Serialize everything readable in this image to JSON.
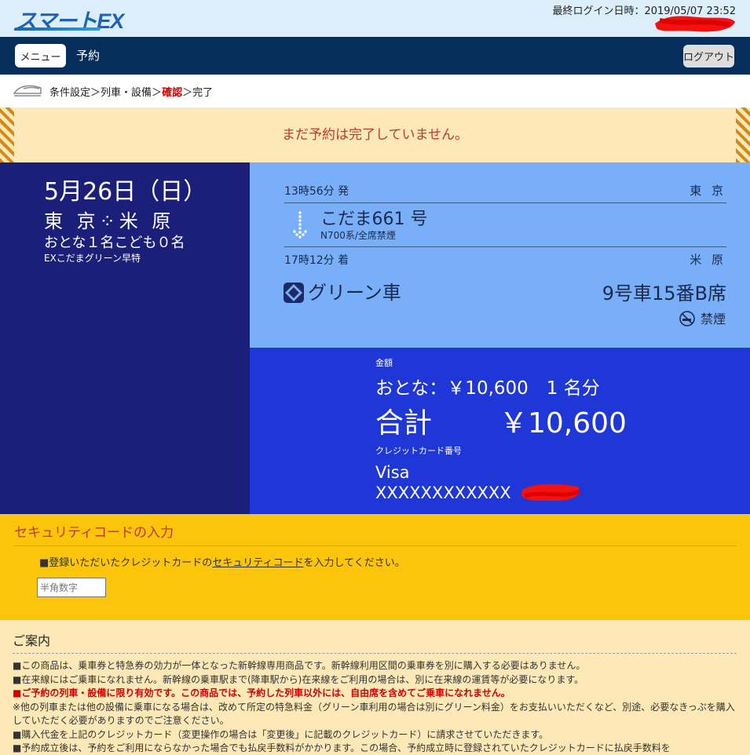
{
  "header": {
    "logo": "スマートEX",
    "last_login": "最終ログイン日時：2019/05/07 23:52"
  },
  "nav": {
    "menu_label": "メニュー",
    "title": "予約",
    "logout_label": "ログアウト"
  },
  "breadcrumb": {
    "step1": "条件設定",
    "sep1": "＞",
    "step2": "列車・設備",
    "sep2": "＞",
    "step3": "確認",
    "sep3": "＞",
    "step4": "完了"
  },
  "warning": "まだ予約は完了していません。",
  "summary": {
    "date": "5月26日（日）",
    "route": "東 京⁘米 原",
    "passengers": "おとな１名こども０名",
    "fare_type": "EXこだまグリーン早特"
  },
  "train": {
    "dep_time": "13時56分 発",
    "dep_station": "東 京",
    "name": "こだま661 号",
    "type": "N700系/全席禁煙",
    "arr_time": "17時12分 着",
    "arr_station": "米 原",
    "car_class": "グリーン車",
    "seat": "9号車15番B席",
    "smoking": "禁煙"
  },
  "fare": {
    "label": "金額",
    "line": "おとな：￥10,600　1 名分",
    "total_label": "合計",
    "total_value": "￥10,600",
    "card_label": "クレジットカード番号",
    "card_brand": "Visa",
    "card_number": "XXXXXXXXXXXX"
  },
  "security": {
    "title": "セキュリティコードの入力",
    "note_pre": "■登録いただいたクレジットカードの",
    "note_link": "セキュリティコード",
    "note_post": "を入力してください。",
    "placeholder": "半角数字"
  },
  "info": {
    "title": "ご案内",
    "line1": "■この商品は、乗車券と特急券の効力が一体となった新幹線専用商品です。新幹線利用区間の乗車券を別に購入する必要はありません。",
    "line2": "■在来線にはご乗車になれません。新幹線の乗車駅まで(降車駅から)在来線をご利用の場合は、別に在来線の運賃等が必要になります。",
    "line3": "■ご予約の列車・設備に限り有効です。この商品では、予約した列車以外には、自由席を含めてご乗車になれません。",
    "line4": "※他の列車または他の設備に乗車になる場合は、改めて所定の特急料金（グリーン車利用の場合は別にグリーン料金）をお支払いいただくなど、別途、必要なきっぷを購入していただく必要がありますのでご注意ください。",
    "line5": "■購入代金を上記のクレジットカード（変更操作の場合は「変更後」に記載のクレジットカード）に請求させていただきます。",
    "line6": "■予約成立後は、予約をご利用にならなかった場合でも払戻手数料がかかります。この場合、予約成立時に登録されていたクレジットカードに払戻手数料を"
  }
}
